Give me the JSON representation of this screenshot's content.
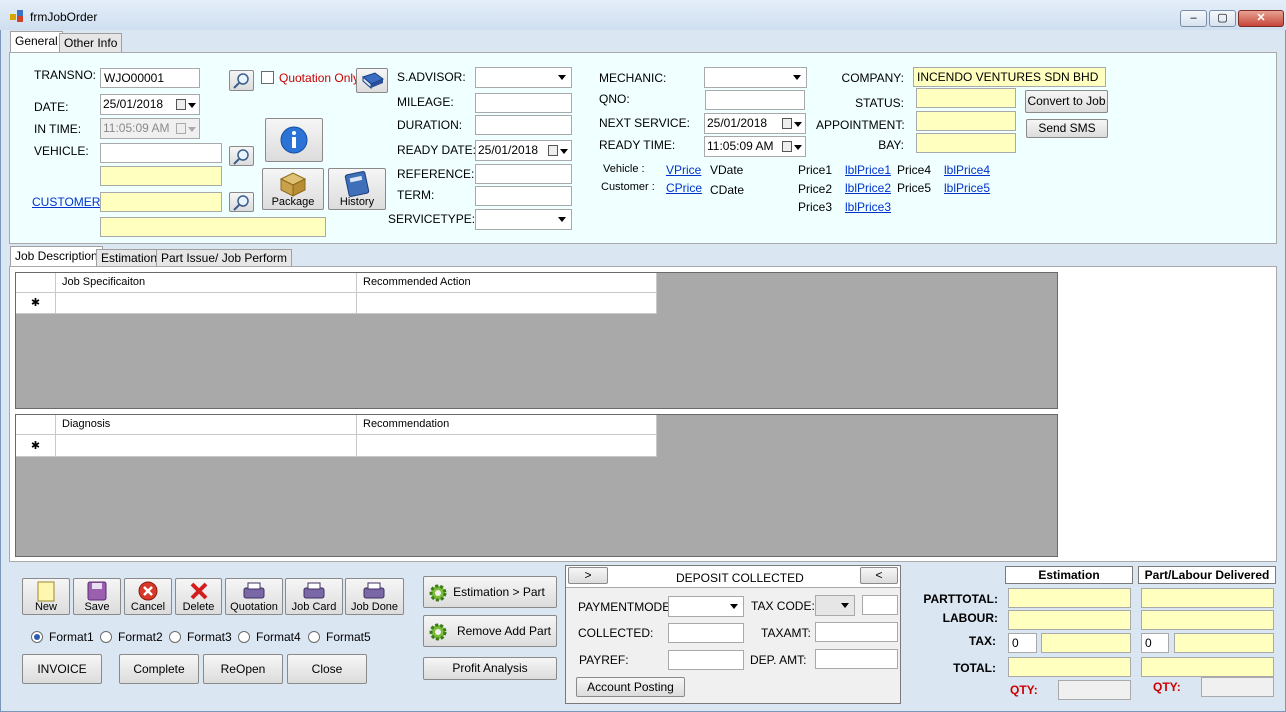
{
  "window": {
    "title": "frmJobOrder",
    "minimize": "–",
    "maximize": "▢",
    "close": "✕"
  },
  "top_tabs": [
    "General",
    "Other Info"
  ],
  "general": {
    "transno_label": "TRANSNO:",
    "transno_value": "WJO00001",
    "quotation_only": "Quotation Only",
    "date_label": "DATE:",
    "date_value": "25/01/2018",
    "intime_label": "IN TIME:",
    "intime_value": "11:05:09 AM",
    "vehicle_label": "VEHICLE:",
    "customer_label": "CUSTOMER",
    "package_label": "Package",
    "history_label": "History",
    "sadvisor_label": "S.ADVISOR:",
    "mileage_label": "MILEAGE:",
    "duration_label": "DURATION:",
    "readydate_label": "READY DATE:",
    "readydate_value": "25/01/2018",
    "reference_label": "REFERENCE:",
    "term_label": "TERM:",
    "servicetype_label": "SERVICETYPE:",
    "mechanic_label": "MECHANIC:",
    "qno_label": "QNO:",
    "nextservice_label": "NEXT SERVICE:",
    "nextservice_value": "25/01/2018",
    "readytime_label": "READY TIME:",
    "readytime_value": "11:05:09 AM",
    "vehicle_price_label": "Vehicle :",
    "vprice": "VPrice",
    "vdate": "VDate",
    "customer_price_label": "Customer :",
    "cprice": "CPrice",
    "cdate": "CDate",
    "price1": "Price1",
    "price2": "Price2",
    "price3": "Price3",
    "price4": "Price4",
    "price5": "Price5",
    "lblprice1": "lblPrice1",
    "lblprice2": "lblPrice2",
    "lblprice3": "lblPrice3",
    "lblprice4": "lblPrice4",
    "lblprice5": "lblPrice5",
    "company_label": "COMPANY:",
    "company_value": "INCENDO VENTURES SDN BHD",
    "status_label": "STATUS:",
    "appointment_label": "APPOINTMENT:",
    "bay_label": "BAY:",
    "convert_label": "Convert to Job",
    "sms_label": "Send SMS"
  },
  "job_tabs": [
    "Job Description",
    "Estimation",
    "Part Issue/ Job Perform"
  ],
  "grid1": {
    "columns": [
      "Job Specificaiton",
      "Recommended Action"
    ],
    "new_row_marker": "✱"
  },
  "grid2": {
    "columns": [
      "Diagnosis",
      "Recommendation"
    ],
    "new_row_marker": "✱"
  },
  "toolbar": {
    "new": "New",
    "save": "Save",
    "cancel": "Cancel",
    "delete": "Delete",
    "quotation": "Quotation",
    "jobcard": "Job Card",
    "jobdone": "Job Done"
  },
  "formats": [
    "Format1",
    "Format2",
    "Format3",
    "Format4",
    "Format5"
  ],
  "actions": {
    "invoice": "INVOICE",
    "complete": "Complete",
    "reopen": "ReOpen",
    "close": "Close"
  },
  "mid_actions": {
    "estimation_issue": "Estimation > Part Issue",
    "remove_add_part": "Remove Add Part",
    "profit_analysis": "Profit Analysis"
  },
  "deposit": {
    "title": "DEPOSIT COLLECTED",
    "prev": ">",
    "next": "<",
    "paymentmode": "PAYMENTMODE:",
    "taxcode": "TAX CODE:",
    "collected": "COLLECTED:",
    "taxamt": "TAXAMT:",
    "payref": "PAYREF:",
    "depamt": "DEP. AMT:",
    "account_posting": "Account Posting"
  },
  "totals": {
    "parttotal": "PARTTOTAL:",
    "labour": "LABOUR:",
    "tax": "TAX:",
    "total": "TOTAL:",
    "estimation": "Estimation",
    "delivered": "Part/Labour Delivered",
    "tax_est": "0",
    "tax_del": "0",
    "qty": "QTY:"
  },
  "colors": {
    "panel_bg": "#f0ffff",
    "yellow": "#ffffc0",
    "link": "#0033cc",
    "red": "#cc0000"
  }
}
